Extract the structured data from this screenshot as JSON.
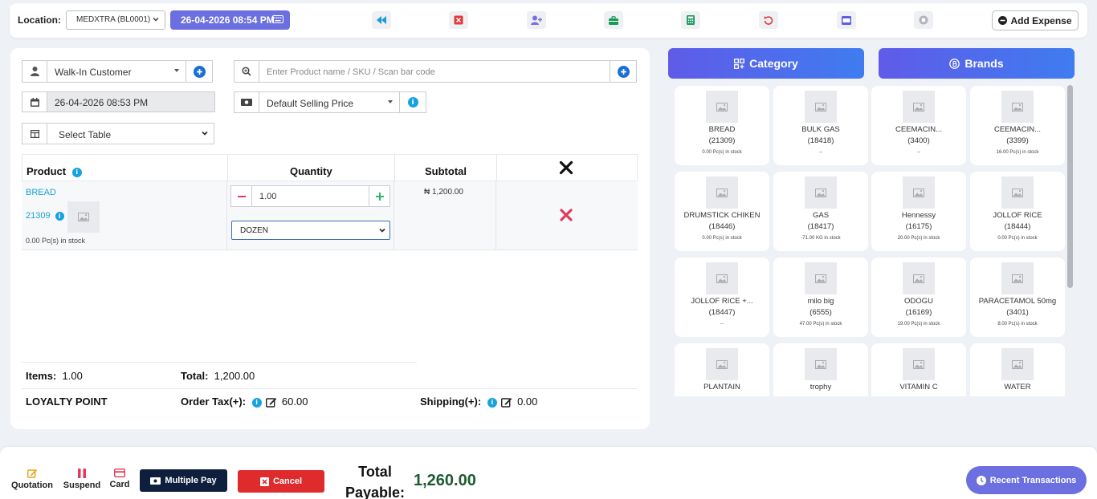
{
  "topbar": {
    "location_label": "Location:",
    "location_value": "MEDXTRA (BL0001)",
    "datetime": "26-04-2026 08:54 PM",
    "add_expense_label": "Add Expense",
    "icons": [
      "rewind-icon",
      "close-box-icon",
      "add-user-icon",
      "briefcase-icon",
      "calculator-icon",
      "undo-icon",
      "window-icon",
      "stop-icon"
    ],
    "icon_colors": [
      "#1a9ad6",
      "#e03b3b",
      "#7a6fe0",
      "#1a9a5a",
      "#1a9a5a",
      "#e03b3b",
      "#5b5fe0",
      "#b0b4ba"
    ]
  },
  "form": {
    "customer": "Walk-In Customer",
    "search_placeholder": "Enter Product name / SKU / Scan bar code",
    "date": "26-04-2026 08:53 PM",
    "price_group": "Default Selling Price",
    "table_select": "Select Table"
  },
  "table": {
    "headers": {
      "product": "Product",
      "quantity": "Quantity",
      "subtotal": "Subtotal"
    },
    "rows": [
      {
        "name": "BREAD",
        "sku": "21309",
        "stock": "0.00 Pc(s) in stock",
        "qty": "1.00",
        "unit": "DOZEN",
        "subtotal": "₦ 1,200.00"
      }
    ]
  },
  "summary": {
    "items_label": "Items:",
    "items_value": "1.00",
    "total_label": "Total:",
    "total_value": "1,200.00",
    "loyalty_label": "LOYALTY POINT",
    "tax_label": "Order Tax(+):",
    "tax_value": "60.00",
    "shipping_label": "Shipping(+):",
    "shipping_value": "0.00"
  },
  "right": {
    "category_label": "Category",
    "brands_label": "Brands",
    "products": [
      {
        "name": "BREAD",
        "code": "(21309)",
        "stock": "0.00 Pc(s) in stock"
      },
      {
        "name": "BULK GAS",
        "code": "(18418)",
        "stock": "--"
      },
      {
        "name": "CEEMACIN...",
        "code": "(3400)",
        "stock": "--"
      },
      {
        "name": "CEEMACIN...",
        "code": "(3399)",
        "stock": "16.00 Pc(s) in stock"
      },
      {
        "name": "DRUMSTICK CHIKEN",
        "code": "(18446)",
        "stock": "0.00 Pc(s) in stock"
      },
      {
        "name": "GAS",
        "code": "(18417)",
        "stock": "-71.00 KG in stock"
      },
      {
        "name": "Hennessy",
        "code": "(16175)",
        "stock": "20.00 Pc(s) in stock"
      },
      {
        "name": "JOLLOF RICE",
        "code": "(18444)",
        "stock": "0.00 Pc(s) in stock"
      },
      {
        "name": "JOLLOF RICE +...",
        "code": "(18447)",
        "stock": "--"
      },
      {
        "name": "milo big",
        "code": "(6555)",
        "stock": "47.00 Pc(s) in stock"
      },
      {
        "name": "ODOGU",
        "code": "(16169)",
        "stock": "19.00 Pc(s) in stock"
      },
      {
        "name": "PARACETAMOL 50mg",
        "code": "(3401)",
        "stock": "8.00 Pc(s) in stock"
      },
      {
        "name": "PLANTAIN",
        "code": "",
        "stock": ""
      },
      {
        "name": "trophy",
        "code": "",
        "stock": ""
      },
      {
        "name": "VITAMIN C",
        "code": "",
        "stock": ""
      },
      {
        "name": "WATER",
        "code": "",
        "stock": ""
      }
    ]
  },
  "footer": {
    "quotation": "Quotation",
    "suspend": "Suspend",
    "card": "Card",
    "multiple_pay": "Multiple Pay",
    "cancel": "Cancel",
    "total_payable_line1": "Total",
    "total_payable_line2": "Payable:",
    "total_payable_value": "1,260.00",
    "recent_transactions": "Recent Transactions"
  },
  "colors": {
    "accent": "#6b6fe0",
    "danger": "#df2b2b",
    "dark": "#0d1f3c",
    "total_green": "#1e5a31",
    "link": "#1aa3d6"
  }
}
